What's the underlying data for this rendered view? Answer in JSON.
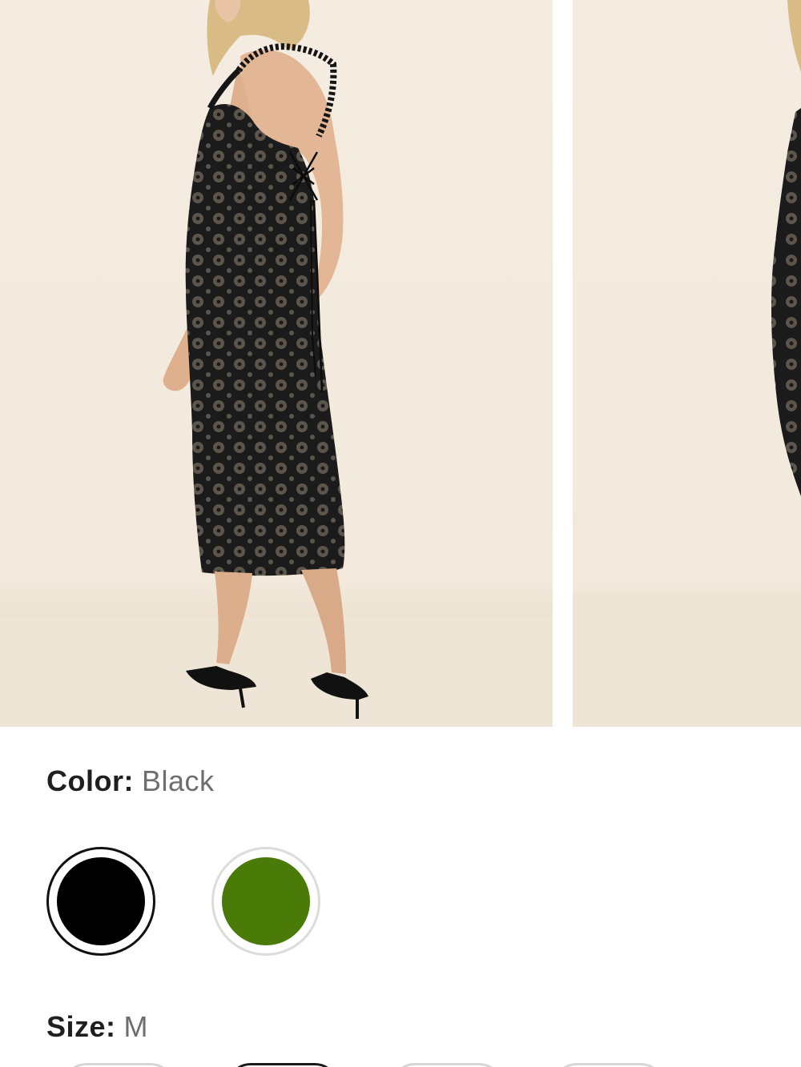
{
  "product_images": [
    {
      "name": "dress-back-view",
      "alt": ""
    },
    {
      "name": "dress-side-view",
      "alt": ""
    }
  ],
  "color": {
    "label": "Color:",
    "selected": "Black",
    "swatches": [
      {
        "name": "Black",
        "hex": "#000000",
        "selected": true
      },
      {
        "name": "Green",
        "hex": "#4a7a08",
        "selected": false
      }
    ]
  },
  "size": {
    "label": "Size:",
    "selected": "M"
  },
  "colors": {
    "text_primary": "#1f1f1f",
    "text_secondary": "#6e6e6e",
    "photo_background": "#f4ece0"
  }
}
